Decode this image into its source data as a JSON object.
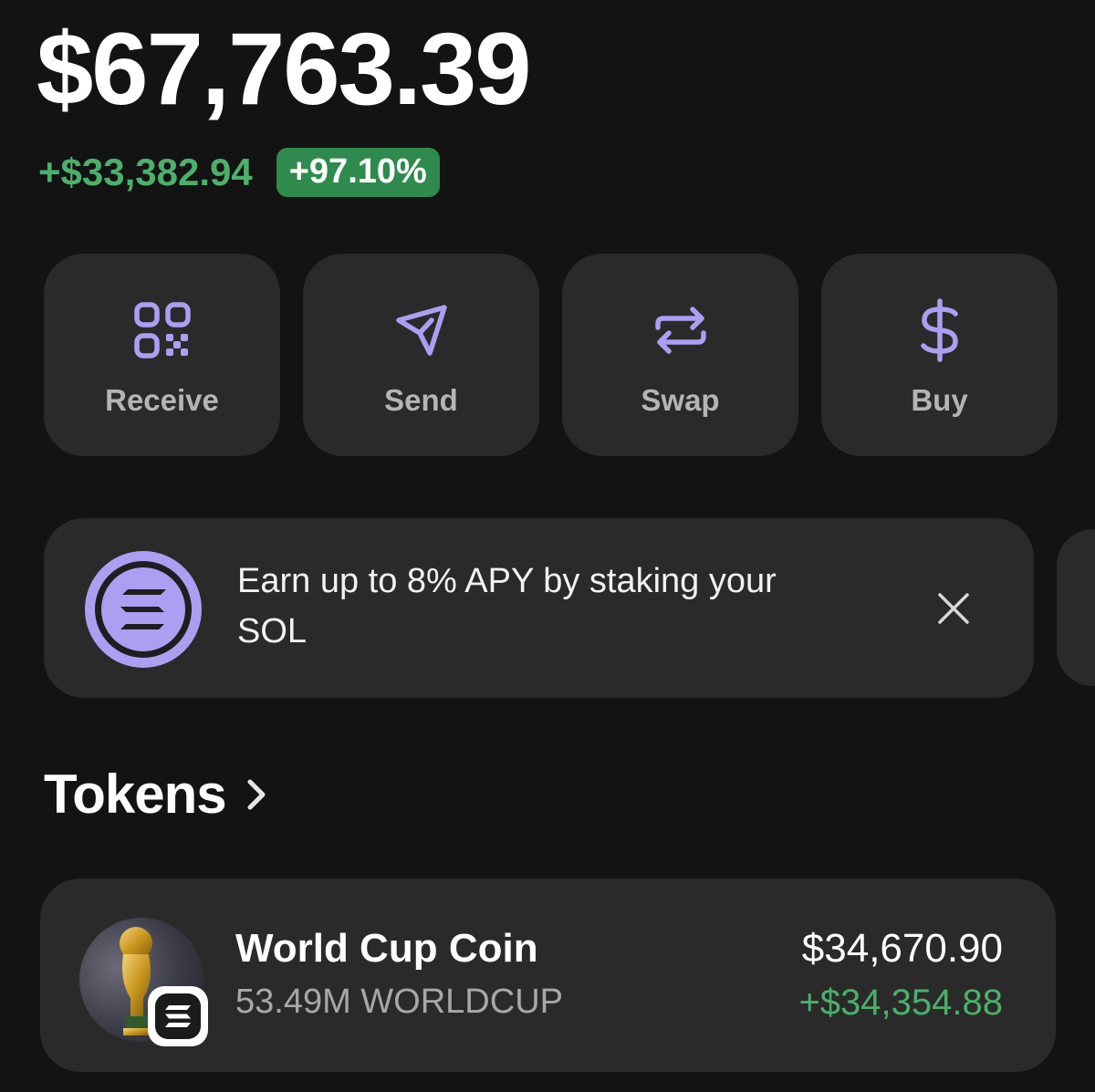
{
  "colors": {
    "background": "#131313",
    "card": "#2a2a2a",
    "accent_purple": "#ab9ff2",
    "positive_green": "#4caf6b",
    "badge_green": "#2f8a4d",
    "label_gray": "#b5b5b5"
  },
  "balance": {
    "total": "$67,763.39",
    "change_amount": "+$33,382.94",
    "change_percent": "+97.10%"
  },
  "actions": [
    {
      "label": "Receive",
      "icon": "qr-code-icon"
    },
    {
      "label": "Send",
      "icon": "send-icon"
    },
    {
      "label": "Swap",
      "icon": "swap-icon"
    },
    {
      "label": "Buy",
      "icon": "dollar-icon"
    }
  ],
  "promo": {
    "text": "Earn up to 8% APY by staking your SOL",
    "logo_icon": "solana-logo-icon",
    "close_icon": "close-icon"
  },
  "tokens": {
    "title": "Tokens",
    "chevron_icon": "chevron-right-icon",
    "items": [
      {
        "name": "World Cup Coin",
        "amount": "53.49M WORLDCUP",
        "value": "$34,670.90",
        "change": "+$34,354.88",
        "avatar_icon": "trophy-icon",
        "chain_badge_icon": "solana-badge-icon"
      }
    ]
  }
}
